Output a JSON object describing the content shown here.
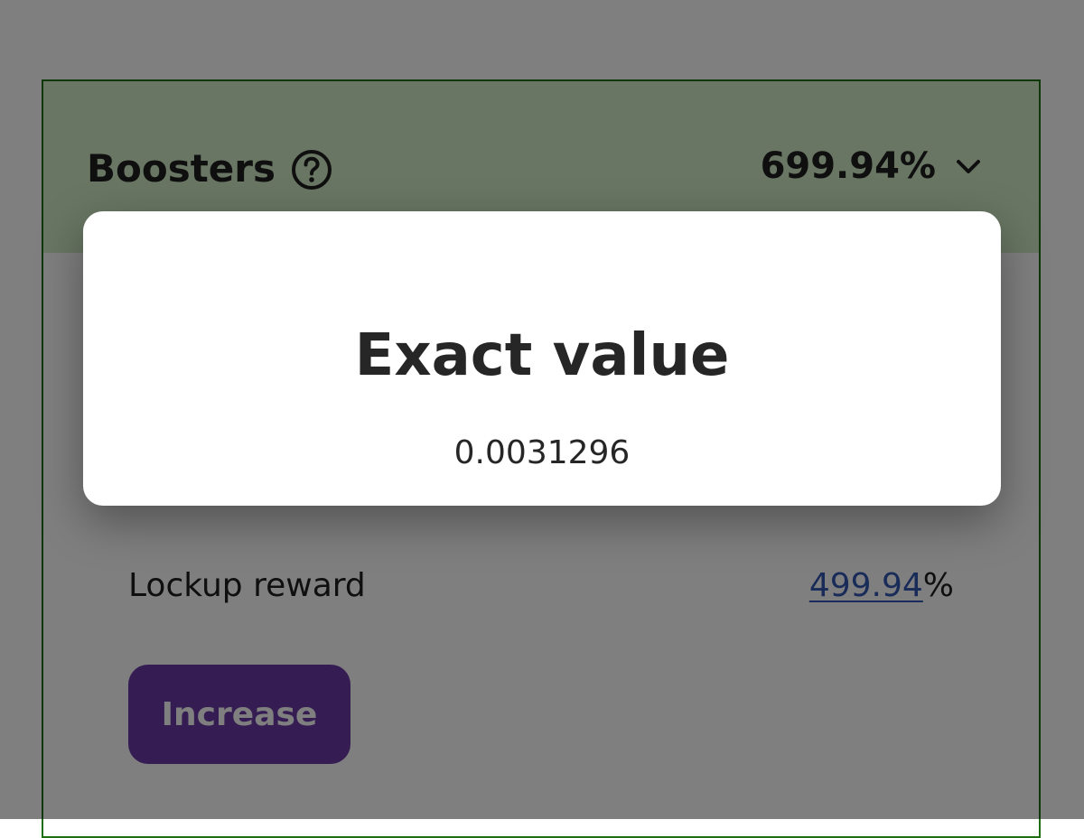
{
  "boosters": {
    "title": "Boosters",
    "value": "699.94%",
    "icons": {
      "help": "question-circle-icon",
      "expand": "chevron-down-icon"
    }
  },
  "lockup_row": {
    "label": "Lockup reward",
    "value_link": "499.94",
    "value_suffix": "%"
  },
  "actions": {
    "increase_label": "Increase"
  },
  "modal": {
    "title": "Exact value",
    "value": "0.0031296"
  },
  "colors": {
    "header_bg": "#d2edc6",
    "card_border": "#1f6e12",
    "link": "#3357b0",
    "button_bg": "#6a3aa8",
    "overlay": "rgba(0,0,0,0.5)"
  }
}
